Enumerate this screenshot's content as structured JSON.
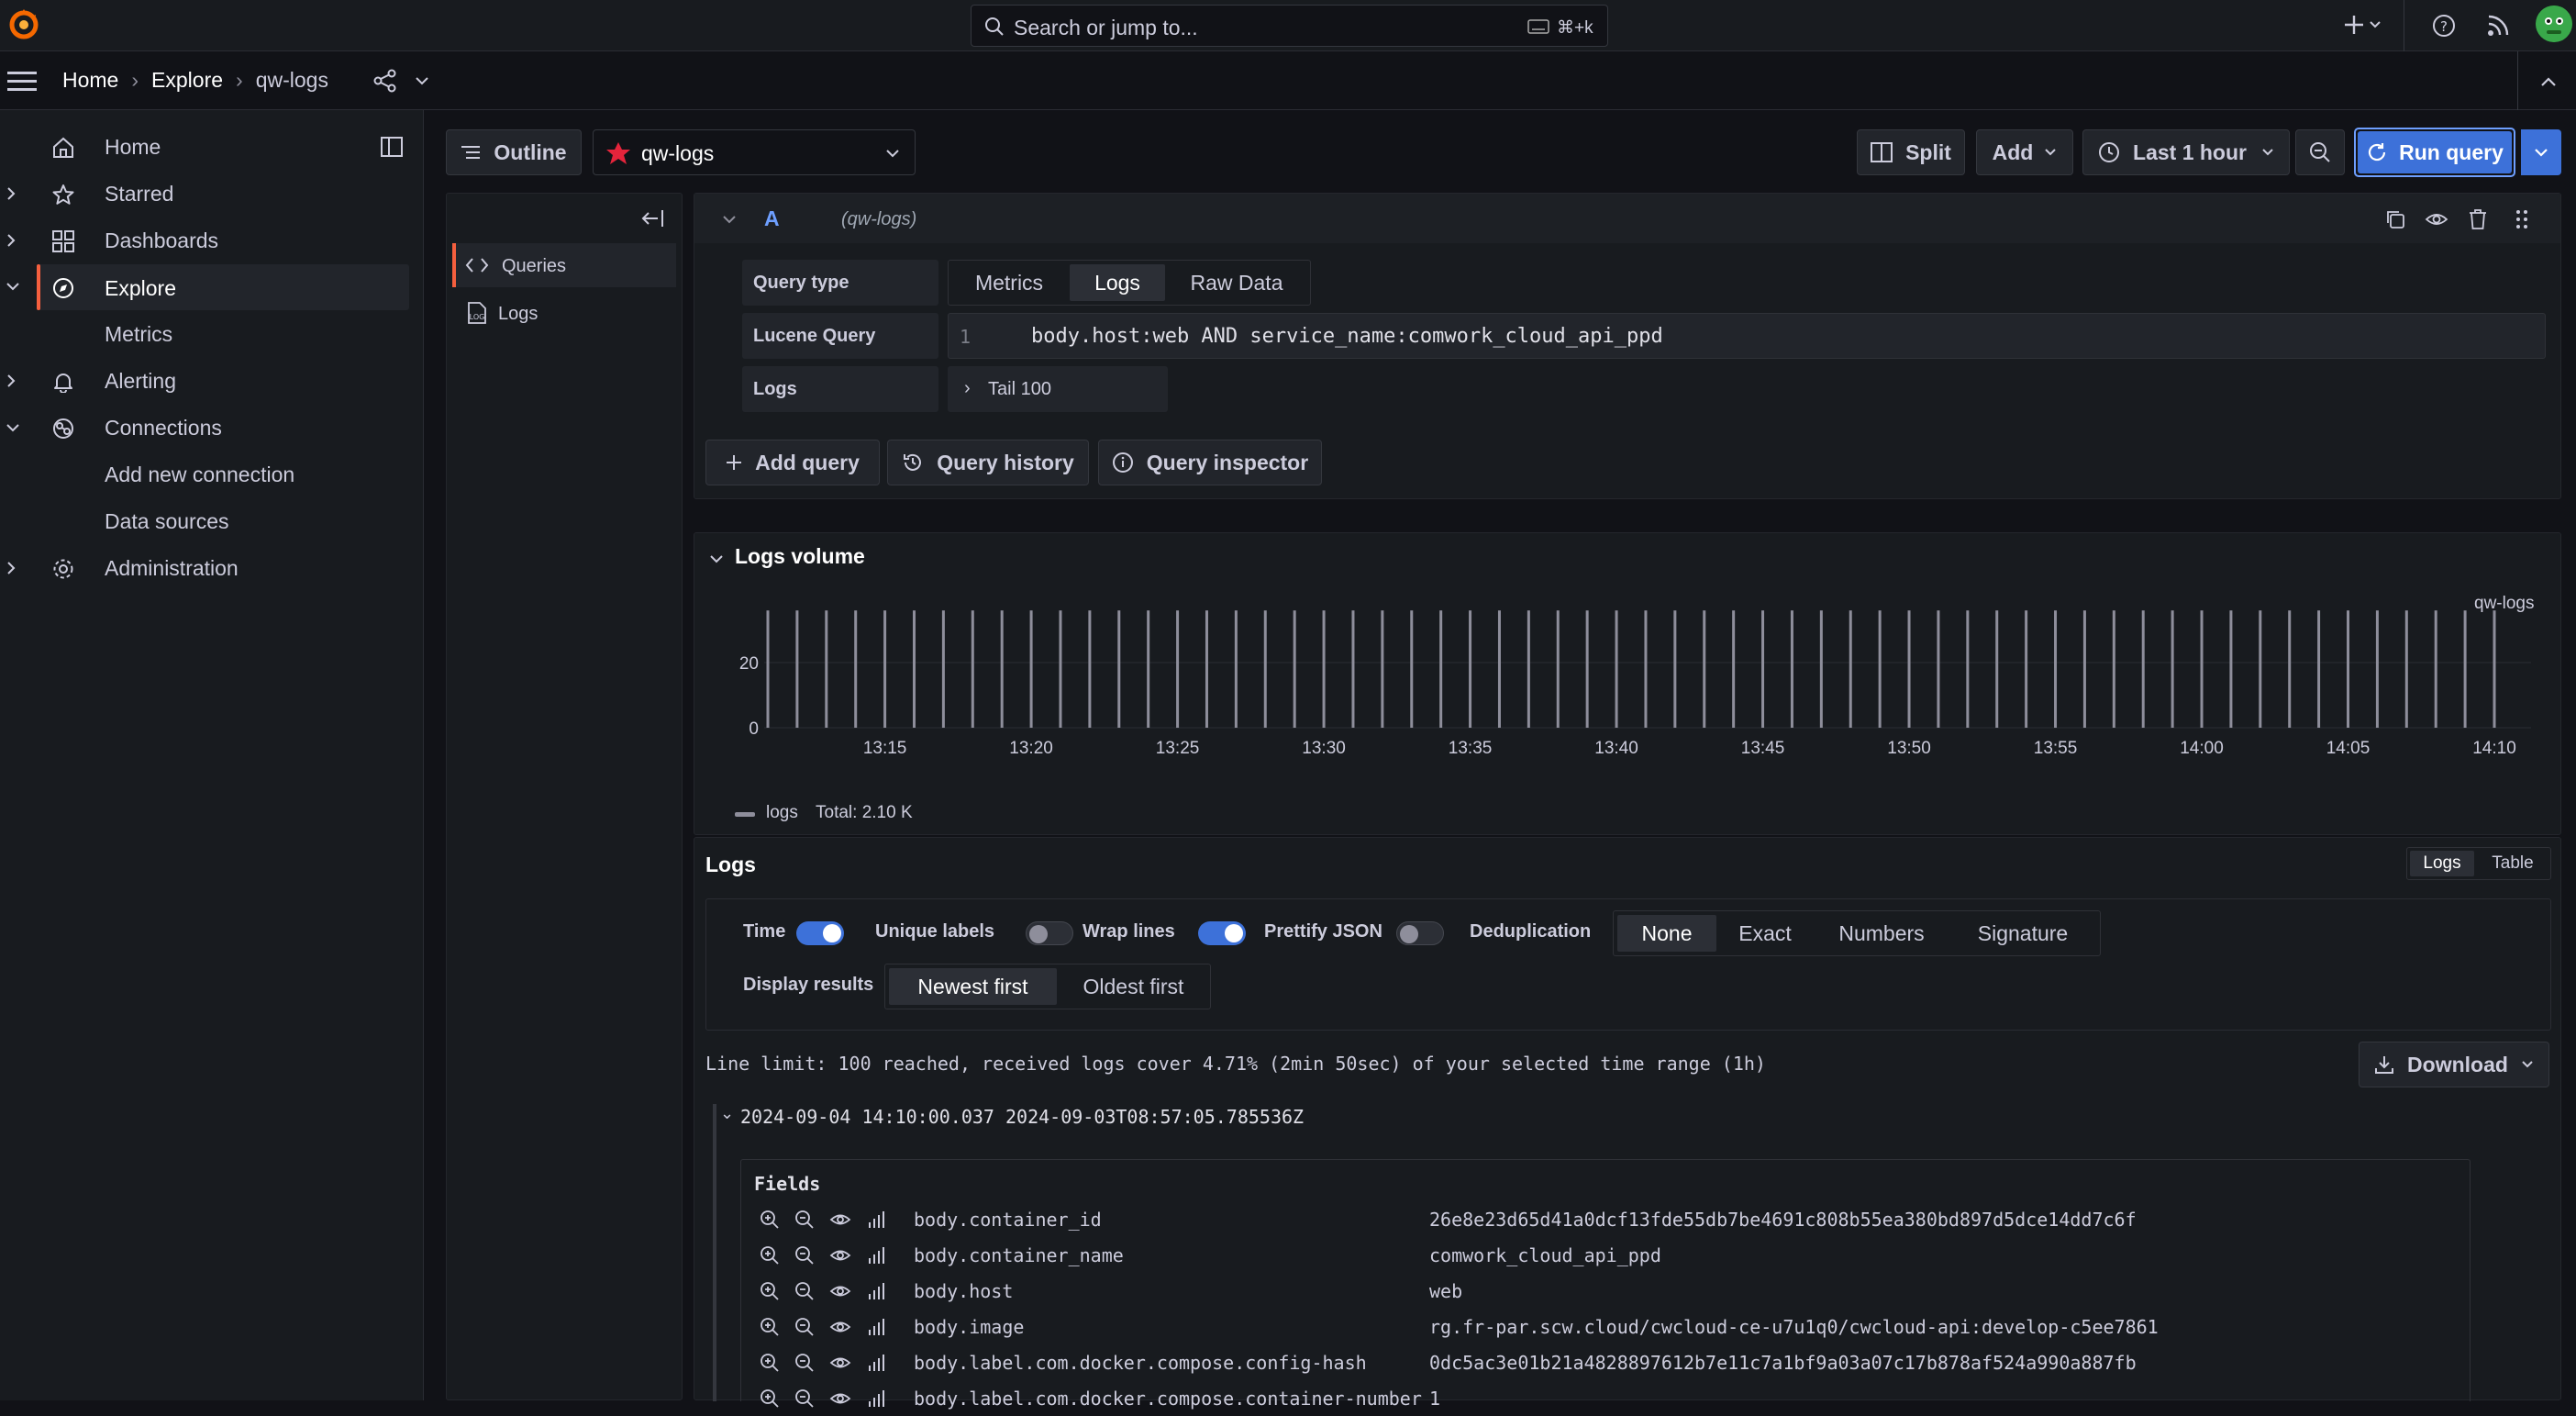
{
  "topbar": {
    "search_placeholder": "Search or jump to...",
    "search_shortcut": "⌘+k",
    "icons": [
      "grafana-logo-icon",
      "search-icon",
      "keyboard-icon",
      "plus-icon",
      "help-icon",
      "rss-icon",
      "avatar"
    ]
  },
  "breadcrumb": {
    "items": [
      "Home",
      "Explore",
      "qw-logs"
    ]
  },
  "sidebar": {
    "items": [
      {
        "label": "Home",
        "icon": "home-icon"
      },
      {
        "label": "Starred",
        "icon": "star-icon"
      },
      {
        "label": "Dashboards",
        "icon": "dashboards-icon"
      },
      {
        "label": "Explore",
        "icon": "compass-icon"
      },
      {
        "label": "Metrics"
      },
      {
        "label": "Alerting",
        "icon": "bell-icon"
      },
      {
        "label": "Connections",
        "icon": "connections-icon"
      },
      {
        "label": "Add new connection"
      },
      {
        "label": "Data sources"
      },
      {
        "label": "Administration",
        "icon": "gear-icon"
      }
    ]
  },
  "toolbar": {
    "outline_label": "Outline",
    "datasource": "qw-logs",
    "split_label": "Split",
    "add_label": "Add",
    "time_range": "Last 1 hour",
    "run_query_label": "Run query"
  },
  "outline": {
    "items": [
      "Queries",
      "Logs"
    ]
  },
  "query": {
    "ref_id": "A",
    "datasource_hint": "(qw-logs)",
    "query_type_label": "Query type",
    "query_types": [
      "Metrics",
      "Logs",
      "Raw Data"
    ],
    "selected_type": "Logs",
    "lucene_label": "Lucene Query",
    "line_number": "1",
    "lucene_value": "body.host:web AND service_name:comwork_cloud_api_ppd",
    "logs_label": "Logs",
    "tail_label": "Tail 100",
    "add_query_label": "Add query",
    "history_label": "Query history",
    "inspector_label": "Query inspector"
  },
  "volume": {
    "title": "Logs volume",
    "series_name": "qw-logs",
    "legend_label": "logs",
    "legend_total": "Total: 2.10 K"
  },
  "chart_data": {
    "type": "bar",
    "x_ticks": [
      "13:15",
      "13:20",
      "13:25",
      "13:30",
      "13:35",
      "13:40",
      "13:45",
      "13:50",
      "13:55",
      "14:00",
      "14:05",
      "14:10"
    ],
    "y_ticks": [
      0,
      20
    ],
    "ylim": [
      0,
      40
    ],
    "series": [
      {
        "name": "logs",
        "start": "13:11",
        "end": "14:10",
        "interval_min": 1,
        "values": [
          36,
          36,
          36,
          36,
          36,
          36,
          36,
          36,
          36,
          36,
          36,
          36,
          36,
          36,
          36,
          36,
          36,
          36,
          36,
          36,
          36,
          36,
          36,
          36,
          36,
          36,
          36,
          36,
          36,
          36,
          36,
          36,
          36,
          36,
          36,
          36,
          36,
          36,
          36,
          36,
          36,
          36,
          36,
          36,
          36,
          36,
          36,
          36,
          36,
          36,
          36,
          36,
          36,
          36,
          36,
          36,
          36,
          36,
          36,
          36
        ]
      }
    ],
    "grid": true,
    "legend": "bottom-left"
  },
  "logs": {
    "title": "Logs",
    "view_options": [
      "Logs",
      "Table"
    ],
    "selected_view": "Logs",
    "time_label": "Time",
    "unique_labels_label": "Unique labels",
    "wrap_lines_label": "Wrap lines",
    "prettify_label": "Prettify JSON",
    "dedup_label": "Deduplication",
    "dedup_options": [
      "None",
      "Exact",
      "Numbers",
      "Signature"
    ],
    "dedup_selected": "None",
    "display_results_label": "Display results",
    "order_options": [
      "Newest first",
      "Oldest first"
    ],
    "order_selected": "Newest first",
    "line_limit": "Line limit: 100 reached, received logs cover 4.71% (2min 50sec) of your selected time range (1h)",
    "download_label": "Download",
    "entry_header": "2024-09-04 14:10:00.037 2024-09-03T08:57:05.785536Z",
    "fields_title": "Fields",
    "fields": [
      {
        "key": "body.container_id",
        "value": "26e8e23d65d41a0dcf13fde55db7be4691c808b55ea380bd897d5dce14dd7c6f"
      },
      {
        "key": "body.container_name",
        "value": "comwork_cloud_api_ppd"
      },
      {
        "key": "body.host",
        "value": "web"
      },
      {
        "key": "body.image",
        "value": "rg.fr-par.scw.cloud/cwcloud-ce-u7u1q0/cwcloud-api:develop-c5ee7861"
      },
      {
        "key": "body.label.com.docker.compose.config-hash",
        "value": "0dc5ac3e01b21a4828897612b7e11c7a1bf9a03a07c17b878af524a990a887fb"
      },
      {
        "key": "body.label.com.docker.compose.container-number",
        "value": "1"
      }
    ]
  }
}
